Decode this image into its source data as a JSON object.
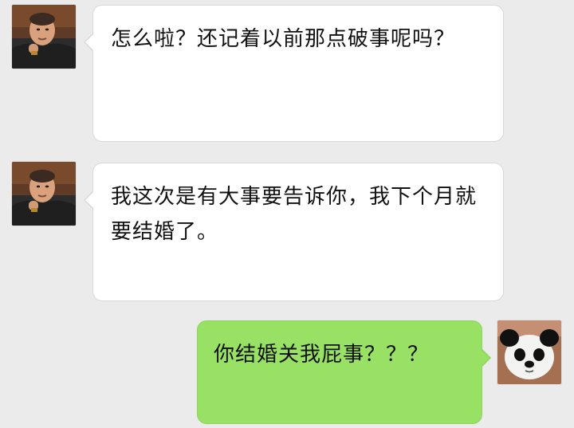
{
  "chat": {
    "messages": [
      {
        "side": "left",
        "sender_avatar": "man-avatar",
        "text": "怎么啦？还记着以前那点破事呢吗？"
      },
      {
        "side": "left",
        "sender_avatar": "man-avatar",
        "text": "我这次是有大事要告诉你，我下个月就要结婚了。"
      },
      {
        "side": "right",
        "sender_avatar": "panda-avatar",
        "text": "你结婚关我屁事？？？"
      }
    ]
  },
  "colors": {
    "background": "#ebebeb",
    "incoming_bubble": "#ffffff",
    "outgoing_bubble": "#98e165"
  }
}
